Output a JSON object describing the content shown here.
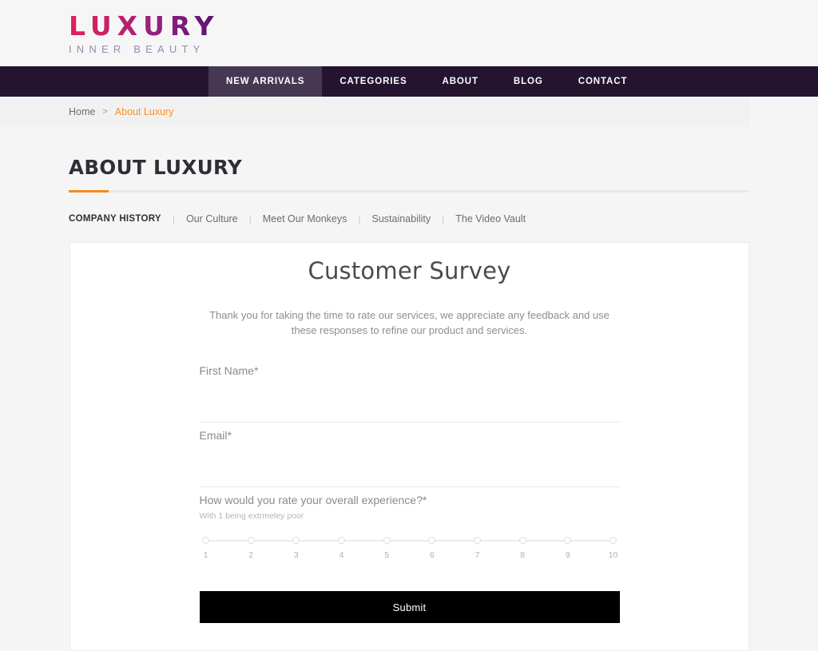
{
  "brand": {
    "name": "LUXURY",
    "tagline": "INNER BEAUTY",
    "gradient_start": "#e1215b",
    "gradient_end": "#53156e"
  },
  "main_nav": {
    "background": "#241430",
    "active_background": "#463852",
    "items": [
      {
        "label": "NEW ARRIVALS",
        "active": true
      },
      {
        "label": "CATEGORIES",
        "active": false
      },
      {
        "label": "ABOUT",
        "active": false
      },
      {
        "label": "BLOG",
        "active": false
      },
      {
        "label": "CONTACT",
        "active": false
      }
    ]
  },
  "breadcrumb": {
    "home": "Home",
    "separator": ">",
    "current": "About Luxury",
    "current_color": "#f7911e"
  },
  "page": {
    "title": "ABOUT LUXURY",
    "accent_color": "#f7871f"
  },
  "sub_nav": {
    "separator": "|",
    "items": [
      {
        "label": "COMPANY HISTORY",
        "active": true
      },
      {
        "label": "Our Culture",
        "active": false
      },
      {
        "label": "Meet Our Monkeys",
        "active": false
      },
      {
        "label": "Sustainability",
        "active": false
      },
      {
        "label": "The Video Vault",
        "active": false
      }
    ]
  },
  "survey": {
    "title": "Customer Survey",
    "intro": "Thank you for taking the time to rate our services, we appreciate any feedback and use these responses to refine our product and services.",
    "fields": [
      {
        "label": "First Name",
        "required_mark": "*",
        "value": "",
        "placeholder": ""
      },
      {
        "label": "Email",
        "required_mark": "*",
        "value": "",
        "placeholder": ""
      }
    ],
    "rating": {
      "question": "How would you rate your overall experience?",
      "required_mark": "*",
      "hint": "With 1 being extrmeley poor",
      "scale": [
        "1",
        "2",
        "3",
        "4",
        "5",
        "6",
        "7",
        "8",
        "9",
        "10"
      ],
      "selected": null
    },
    "submit_label": "Submit",
    "submit_background": "#000000"
  }
}
